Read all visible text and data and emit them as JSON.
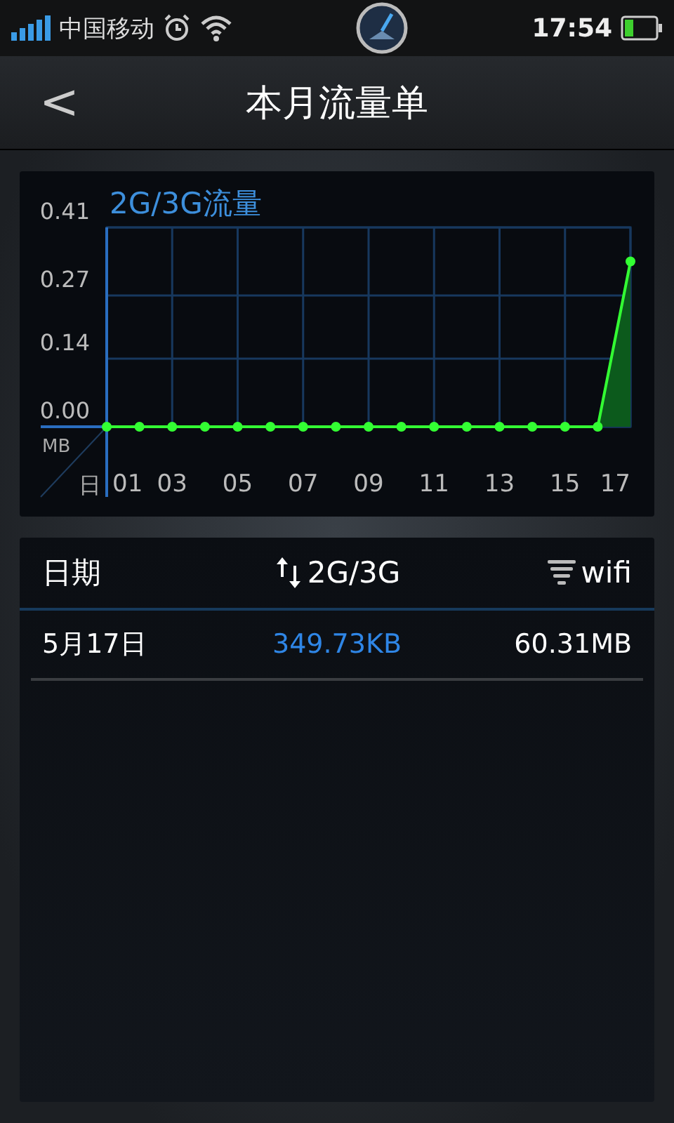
{
  "status_bar": {
    "carrier": "中国移动",
    "time": "17:54"
  },
  "header": {
    "back": "<",
    "title": "本月流量单"
  },
  "chart": {
    "chart_data": {
      "type": "area",
      "title": "2G/3G流量",
      "xlabel": "日",
      "ylabel": "MB",
      "x": [
        1,
        2,
        3,
        4,
        5,
        6,
        7,
        8,
        9,
        10,
        11,
        12,
        13,
        14,
        15,
        16,
        17
      ],
      "grid": true,
      "series": [
        {
          "color": "#33ff33",
          "values": [
            0,
            0,
            0,
            0,
            0,
            0,
            0,
            0,
            0,
            0,
            0,
            0,
            0,
            0,
            0,
            0,
            0.34
          ]
        }
      ],
      "xlim": [
        1,
        17
      ],
      "ylim": [
        0,
        0.41
      ],
      "xticks": [
        {
          "value": 1,
          "label": "01"
        },
        {
          "value": 3,
          "label": "03"
        },
        {
          "value": 5,
          "label": "05"
        },
        {
          "value": 7,
          "label": "07"
        },
        {
          "value": 9,
          "label": "09"
        },
        {
          "value": 11,
          "label": "11"
        },
        {
          "value": 13,
          "label": "13"
        },
        {
          "value": 15,
          "label": "15"
        },
        {
          "value": 17,
          "label": "17"
        }
      ],
      "yticks": [
        {
          "value": 0,
          "label": "0.00"
        },
        {
          "value": 0.14,
          "label": "0.14"
        },
        {
          "value": 0.27,
          "label": "0.27"
        },
        {
          "value": 0.41,
          "label": "0.41"
        }
      ]
    }
  },
  "table": {
    "columns": [
      {
        "label": "日期",
        "kind": "date"
      },
      {
        "label": "2G/3G",
        "kind": "mobile"
      },
      {
        "label": "wifi",
        "kind": "wifi"
      }
    ],
    "rows": [
      {
        "cells": [
          "5月17日",
          "349.73KB",
          "60.31MB"
        ]
      }
    ]
  }
}
